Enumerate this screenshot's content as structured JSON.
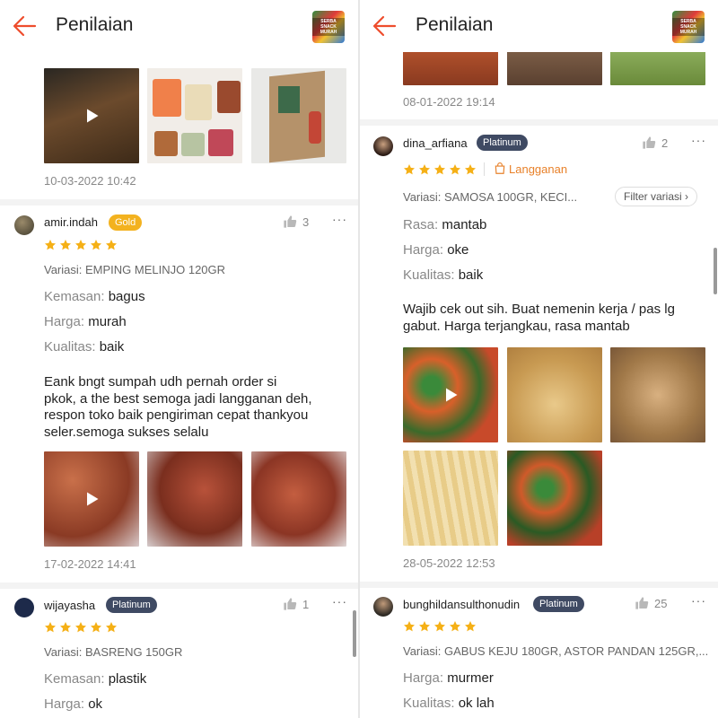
{
  "header": {
    "title": "Penilaian",
    "shop_logo_text": "SERBA SNACK MURAH"
  },
  "left": {
    "top_review": {
      "date": "10-03-2022 10:42"
    },
    "review_amir": {
      "username": "amir.indah",
      "badge": "Gold",
      "likes": "3",
      "rating": 5,
      "variasi": "Variasi: EMPING MELINJO 120GR",
      "attrs": [
        {
          "key": "Kemasan:",
          "value": "bagus"
        },
        {
          "key": "Harga:",
          "value": "murah"
        },
        {
          "key": "Kualitas:",
          "value": "baik"
        }
      ],
      "text_lines": [
        "Eank bngt sumpah udh pernah order si",
        "pkok, a the best semoga jadi langganan deh,",
        "respon toko baik pengiriman cepat thankyou",
        "seler.semoga sukses selalu"
      ],
      "date": "17-02-2022 14:41"
    },
    "review_wija": {
      "username": "wijayasha",
      "badge": "Platinum",
      "likes": "1",
      "rating": 5,
      "variasi": "Variasi: BASRENG 150GR",
      "attrs": [
        {
          "key": "Kemasan:",
          "value": "plastik"
        },
        {
          "key": "Harga:",
          "value": "ok"
        }
      ]
    }
  },
  "right": {
    "top_review": {
      "date": "08-01-2022 19:14"
    },
    "review_dina": {
      "username": "dina_arfiana",
      "badge": "Platinum",
      "likes": "2",
      "rating": 5,
      "langganan": "Langganan",
      "variasi": "Variasi: SAMOSA 100GR, KECI...",
      "filter_label": "Filter variasi",
      "attrs": [
        {
          "key": "Rasa:",
          "value": "mantab"
        },
        {
          "key": "Harga:",
          "value": "oke"
        },
        {
          "key": "Kualitas:",
          "value": "baik"
        }
      ],
      "text_lines": [
        "Wajib cek out sih. Buat nemenin kerja / pas lg",
        "gabut. Harga terjangkau, rasa mantab"
      ],
      "date": "28-05-2022 12:53"
    },
    "review_bung": {
      "username": "bunghildansulthonudin",
      "badge": "Platinum",
      "likes": "25",
      "rating": 5,
      "variasi": "Variasi: GABUS KEJU 180GR, ASTOR PANDAN 125GR,...",
      "attrs": [
        {
          "key": "Harga:",
          "value": "murmer"
        },
        {
          "key": "Kualitas:",
          "value": "ok lah"
        }
      ]
    }
  },
  "colors": {
    "accent": "#ee4d2d",
    "star": "#f5b016",
    "gold_badge": "#f3b21f",
    "platinum_badge": "#3f4a63",
    "langganan": "#e8812a"
  },
  "icons": [
    "back-arrow-icon",
    "thumbs-up-icon",
    "more-dots-icon",
    "star-icon",
    "play-icon",
    "bag-icon",
    "chevron-right-icon"
  ]
}
